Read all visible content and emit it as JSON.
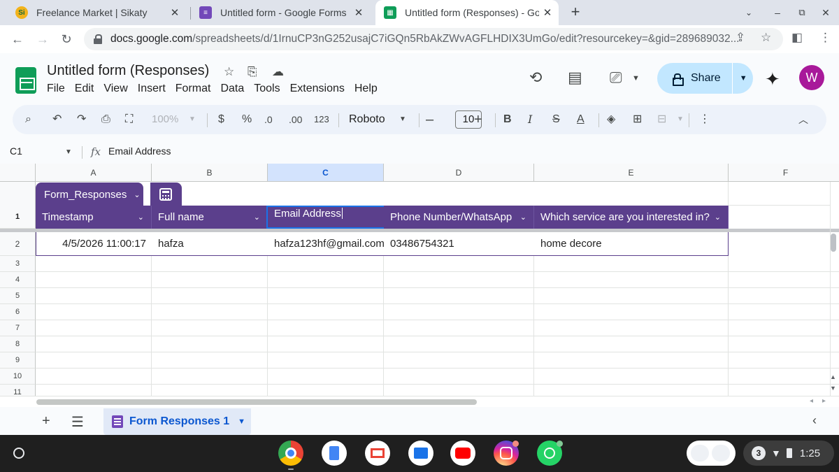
{
  "browser": {
    "tabs": [
      {
        "title": "Freelance Market | Sikaty",
        "active": false
      },
      {
        "title": "Untitled form - Google Forms",
        "active": false
      },
      {
        "title": "Untitled form (Responses) - Goog",
        "active": true
      }
    ],
    "fav_letters": {
      "sikaty": "Si"
    },
    "url_host": "docs.google.com",
    "url_path": "/spreadsheets/d/1IrnuCP3nG252usajC7iGQn5RbAkZWvAGFLHDIX3UmGo/edit?resourcekey=&gid=289689032..."
  },
  "sheets": {
    "doc_title": "Untitled form (Responses)",
    "menu": [
      "File",
      "Edit",
      "View",
      "Insert",
      "Format",
      "Data",
      "Tools",
      "Extensions",
      "Help"
    ],
    "share_label": "Share",
    "avatar_letter": "W"
  },
  "toolbar": {
    "zoom": "100%",
    "currency": "$",
    "percent": "%",
    "dec_decrease": ".0",
    "dec_increase": ".00",
    "number_format": "123",
    "font": "Roboto",
    "font_size": "10",
    "bold": "B",
    "italic": "I",
    "strike": "S",
    "text_color": "A"
  },
  "formula_bar": {
    "name_box": "C1",
    "fx": "fx",
    "value": "Email Address"
  },
  "grid": {
    "columns": [
      "A",
      "B",
      "C",
      "D",
      "E",
      "F"
    ],
    "selected_column": "C",
    "rows": [
      "1",
      "2",
      "3",
      "4",
      "5",
      "6",
      "7",
      "8",
      "9",
      "10",
      "11"
    ],
    "table_name": "Form_Responses",
    "headers": [
      "Timestamp",
      "Full name",
      "Email Address",
      "Phone Number/WhatsApp",
      "Which service are you interested in?"
    ],
    "data_row": [
      "4/5/2026 11:00:17",
      "hafza",
      "hafza123hf@gmail.com",
      "03486754321",
      "home decore"
    ]
  },
  "sheet_tabs": {
    "active_tab": "Form Responses 1"
  },
  "shelf": {
    "notification_count": "3",
    "time": "1:25"
  },
  "colors": {
    "table_header": "#5b3f8c",
    "accent_blue": "#0b57d0",
    "share_bg": "#c2e7ff"
  }
}
